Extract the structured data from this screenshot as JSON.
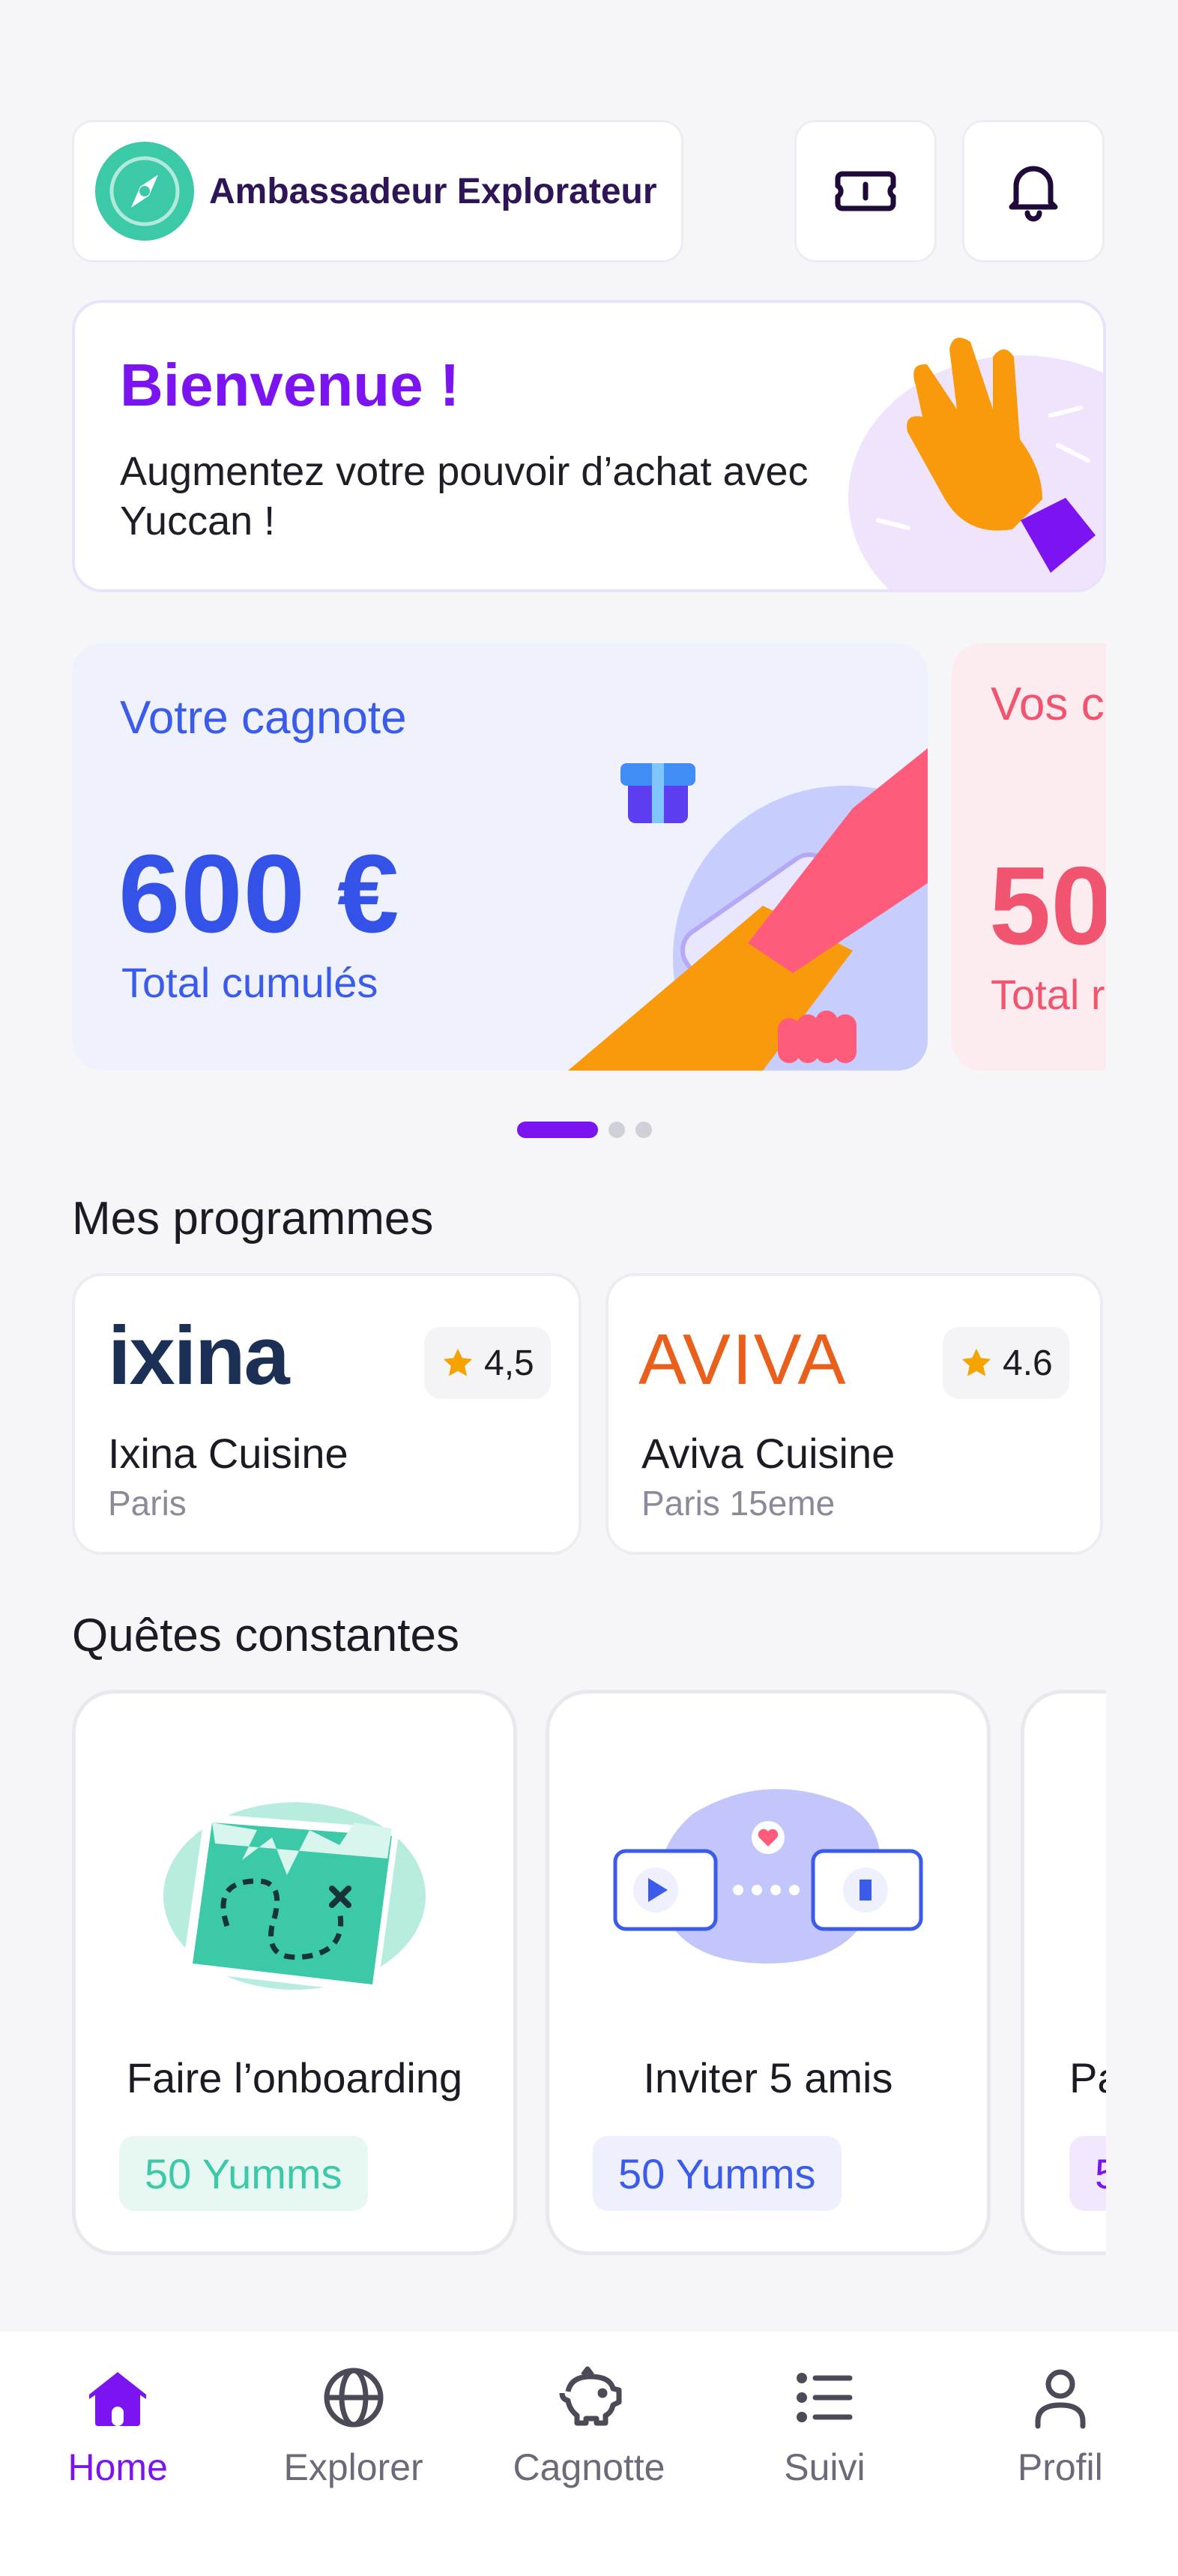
{
  "header": {
    "rank_label": "Ambassadeur Explorateur",
    "rank_icon": "compass-icon",
    "ticket_icon": "ticket-icon",
    "bell_icon": "bell-icon"
  },
  "welcome": {
    "title": "Bienvenue !",
    "subtitle": "Augmentez votre pouvoir d’achat avec Yuccan !"
  },
  "savings": [
    {
      "title": "Votre cagnote",
      "amount": "600 €",
      "caption": "Total cumulés",
      "color": "#3552e8"
    },
    {
      "title": "Vos c",
      "amount": "50",
      "caption": "Total r",
      "color": "#f0546e"
    }
  ],
  "carousel": {
    "pages": 3,
    "active_index": 0
  },
  "programmes": {
    "title": "Mes programmes",
    "items": [
      {
        "logo": "ixina",
        "name": "Ixina Cuisine",
        "city": "Paris",
        "rating": "4,5"
      },
      {
        "logo": "AVIVA",
        "name": "Aviva Cuisine",
        "city": "Paris 15eme",
        "rating": "4.6"
      }
    ]
  },
  "quests": {
    "title": "Quêtes constantes",
    "items": [
      {
        "name": "Faire l’onboarding",
        "reward": "50 Yumms",
        "reward_color": "#3cc9a8",
        "reward_bg": "#e7f8f3"
      },
      {
        "name": "Inviter 5 amis",
        "reward": "50 Yumms",
        "reward_color": "#3b5bea",
        "reward_bg": "#eef1fd"
      },
      {
        "name": "Pa",
        "reward": "5",
        "reward_color": "#7b14f0",
        "reward_bg": "#f1e8fd"
      }
    ]
  },
  "nav": {
    "active": "home",
    "items": [
      {
        "id": "home",
        "label": "Home",
        "icon": "home-icon"
      },
      {
        "id": "explorer",
        "label": "Explorer",
        "icon": "globe-icon"
      },
      {
        "id": "cagnotte",
        "label": "Cagnotte",
        "icon": "piggy-bank-icon"
      },
      {
        "id": "suivi",
        "label": "Suivi",
        "icon": "list-icon"
      },
      {
        "id": "profil",
        "label": "Profil",
        "icon": "user-icon"
      }
    ]
  },
  "colors": {
    "brand_purple": "#7b14f0",
    "brand_blue": "#3552e8",
    "brand_pink": "#f0546e",
    "brand_teal": "#3cc9a8",
    "star": "#f5a300"
  }
}
